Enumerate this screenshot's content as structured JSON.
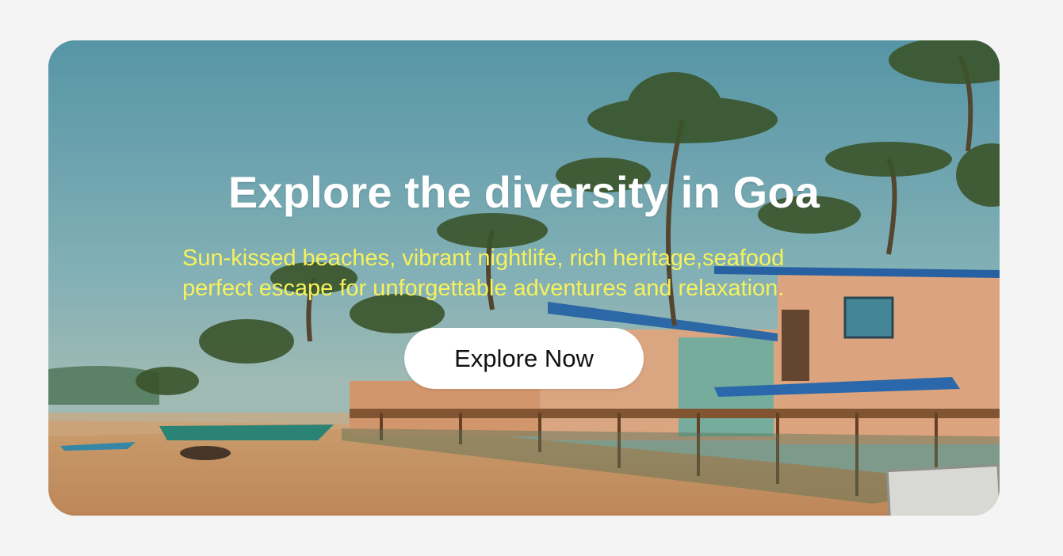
{
  "hero": {
    "image_description_icon": "goa-beach-photo",
    "title": "Explore the diversity in Goa",
    "subtitle_line1": "Sun-kissed beaches, vibrant nightlife, rich heritage,seafood",
    "subtitle_line2": "perfect escape for unforgettable adventures and relaxation.",
    "button_label": "Explore Now"
  },
  "colors": {
    "page_background": "#f4f4f4",
    "title": "#ffffff",
    "subtitle": "#f7f25a",
    "button_background": "#ffffff",
    "button_text": "#111111"
  }
}
